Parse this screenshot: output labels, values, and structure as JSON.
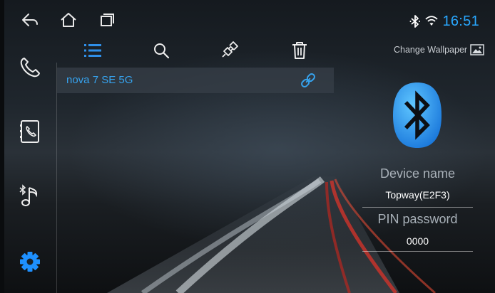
{
  "status_bar": {
    "time": "16:51",
    "icons": [
      "back-icon",
      "home-icon",
      "recent-apps-icon",
      "bluetooth-status-icon",
      "wifi-icon"
    ]
  },
  "sidebar": {
    "items": [
      {
        "name": "phone",
        "icon": "phone-icon"
      },
      {
        "name": "contacts",
        "icon": "contacts-icon"
      },
      {
        "name": "bluetooth-music",
        "icon": "bluetooth-music-icon"
      },
      {
        "name": "settings",
        "icon": "gear-icon",
        "active": true
      }
    ],
    "active_color": "#1e90ff"
  },
  "toolbar": {
    "items": [
      "device-list-icon",
      "search-icon",
      "disconnect-icon",
      "delete-icon"
    ],
    "active_color": "#2f8fe8"
  },
  "device_list": [
    {
      "name": "nova 7 SE 5G",
      "icon": "link-icon"
    }
  ],
  "right_panel": {
    "change_wallpaper": "Change Wallpaper",
    "device_name_label": "Device name",
    "device_name_value": "Topway(E2F3)",
    "pin_label": "PIN password",
    "pin_value": "0000",
    "bt_logo_color": "#1f8fe0"
  }
}
